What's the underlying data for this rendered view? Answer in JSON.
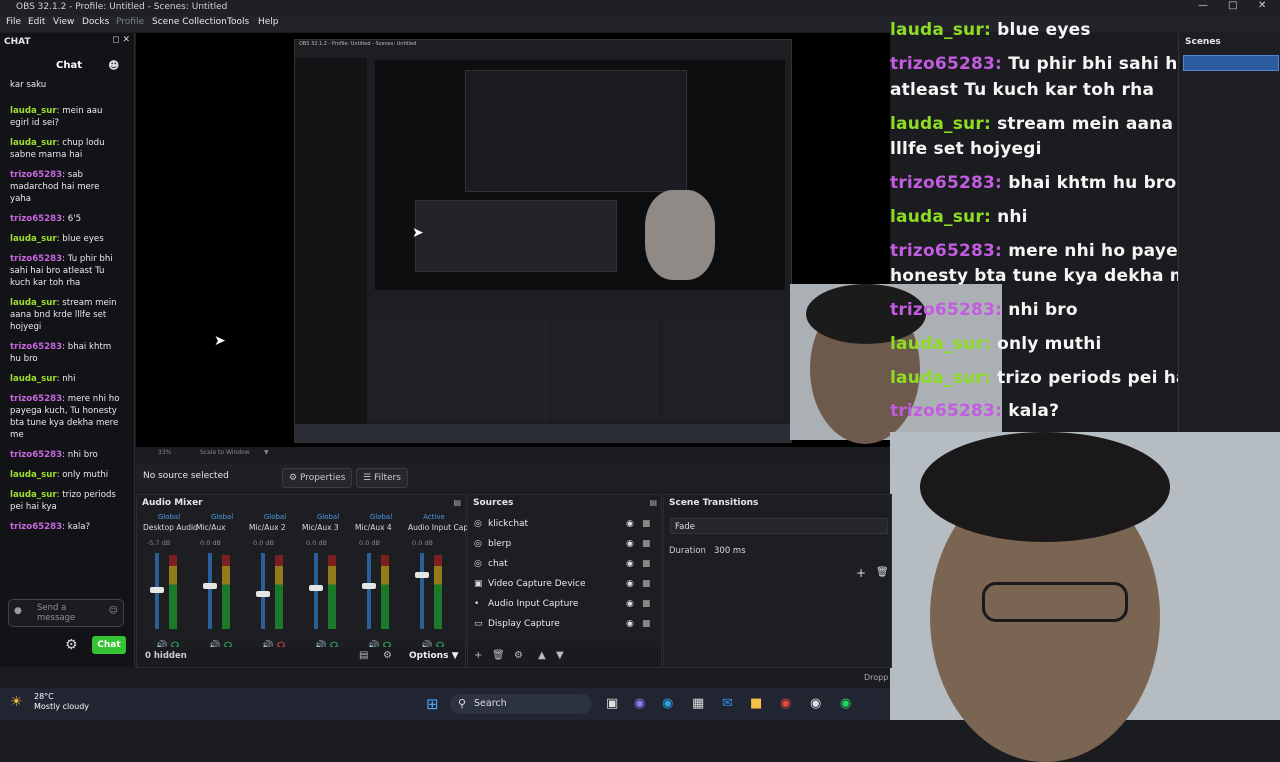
{
  "window": {
    "title": "OBS 32.1.2 - Profile: Untitled - Scenes: Untitled"
  },
  "menu": [
    "File",
    "Edit",
    "View",
    "Docks",
    "Profile",
    "Scene Collection",
    "Tools",
    "Help"
  ],
  "chat_dock": {
    "title": "CHAT",
    "header": "Chat",
    "top_partial": "kar saku",
    "messages": [
      {
        "user": "lauda_sur",
        "kind": "l",
        "text": "mein aau egirl id sei?"
      },
      {
        "user": "lauda_sur",
        "kind": "l",
        "text": "chup lodu sabne marna hai"
      },
      {
        "user": "trizo65283",
        "kind": "t",
        "text": "sab madarchod hai mere yaha"
      },
      {
        "user": "trizo65283",
        "kind": "t",
        "text": "6'5"
      },
      {
        "user": "lauda_sur",
        "kind": "l",
        "text": "blue eyes"
      },
      {
        "user": "trizo65283",
        "kind": "t",
        "text": "Tu phir bhi sahi hai bro atleast Tu kuch kar toh rha"
      },
      {
        "user": "lauda_sur",
        "kind": "l",
        "text": "stream mein aana bnd krde lllfe set hojyegi"
      },
      {
        "user": "trizo65283",
        "kind": "t",
        "text": "bhai khtm hu bro"
      },
      {
        "user": "lauda_sur",
        "kind": "l",
        "text": "nhi"
      },
      {
        "user": "trizo65283",
        "kind": "t",
        "text": "mere nhi ho payega kuch, Tu honesty bta tune kya dekha mere me"
      },
      {
        "user": "trizo65283",
        "kind": "t",
        "text": "nhi bro"
      },
      {
        "user": "lauda_sur",
        "kind": "l",
        "text": "only muthi"
      },
      {
        "user": "lauda_sur",
        "kind": "l",
        "text": "trizo periods pei hai kya"
      },
      {
        "user": "trizo65283",
        "kind": "t",
        "text": "kala?"
      }
    ],
    "send_placeholder": "Send a message",
    "chat_button": "Chat"
  },
  "overlay": [
    {
      "user": "lauda_sur:",
      "kind": "l",
      "text": "blue eyes"
    },
    {
      "user": "trizo65283:",
      "kind": "t",
      "text": "Tu phir bhi sahi hai bro"
    },
    {
      "user": "",
      "kind": "",
      "text": "atleast Tu kuch kar toh rha"
    },
    {
      "user": "lauda_sur:",
      "kind": "l",
      "text": "stream mein aana bnd krde"
    },
    {
      "user": "",
      "kind": "",
      "text": "lllfe set hojyegi"
    },
    {
      "user": "trizo65283:",
      "kind": "t",
      "text": "bhai khtm hu bro"
    },
    {
      "user": "lauda_sur:",
      "kind": "l",
      "text": "nhi"
    },
    {
      "user": "trizo65283:",
      "kind": "t",
      "text": "mere nhi ho payega kuch, T"
    },
    {
      "user": "",
      "kind": "",
      "text": "honesty bta tune kya dekha mere me"
    },
    {
      "user": "trizo65283:",
      "kind": "t",
      "text": "nhi bro"
    },
    {
      "user": "lauda_sur:",
      "kind": "l",
      "text": "only muthi"
    },
    {
      "user": "lauda_sur:",
      "kind": "l",
      "text": "trizo periods pei hai kya"
    },
    {
      "user": "trizo65283:",
      "kind": "t",
      "text": "kala?"
    }
  ],
  "scenes": {
    "title": "Scenes"
  },
  "zoom": {
    "percent": "33%",
    "mode": "Scale to Window"
  },
  "props_bar": {
    "no_source": "No source selected",
    "properties": "Properties",
    "filters": "Filters"
  },
  "audio_mixer": {
    "title": "Audio Mixer",
    "channels": [
      {
        "group": "Global",
        "name": "Desktop Audio",
        "db": "-5.7 dB",
        "level": 0.55
      },
      {
        "group": "Global",
        "name": "Mic/Aux",
        "db": "0.0 dB",
        "level": 0.6
      },
      {
        "group": "Global",
        "name": "Mic/Aux 2",
        "db": "0.0 dB",
        "level": 0.5
      },
      {
        "group": "Global",
        "name": "Mic/Aux 3",
        "db": "0.0 dB",
        "level": 0.58
      },
      {
        "group": "Global",
        "name": "Mic/Aux 4",
        "db": "0.0 dB",
        "level": 0.6
      },
      {
        "group": "Active",
        "name": "Audio Input Capture",
        "db": "0.0 dB",
        "level": 0.75
      }
    ],
    "hidden": "0 hidden",
    "options": "Options"
  },
  "sources": {
    "title": "Sources",
    "items": [
      {
        "name": "klickchat",
        "icon": "browser-icon"
      },
      {
        "name": "blerp",
        "icon": "browser-icon"
      },
      {
        "name": "chat",
        "icon": "browser-icon"
      },
      {
        "name": "Video Capture Device",
        "icon": "camera-icon"
      },
      {
        "name": "Audio Input Capture",
        "icon": "mic-icon"
      },
      {
        "name": "Display Capture",
        "icon": "monitor-icon"
      }
    ]
  },
  "transitions": {
    "title": "Scene Transitions",
    "selected": "Fade",
    "duration_label": "Duration",
    "duration_value": "300 ms"
  },
  "status": {
    "dropped": "Dropp"
  },
  "taskbar": {
    "temp": "28°C",
    "weather": "Mostly cloudy",
    "search": "Search"
  },
  "colors": {
    "lauda": "#9fdf2e",
    "trizo": "#c766e0",
    "accent": "#33c333"
  }
}
